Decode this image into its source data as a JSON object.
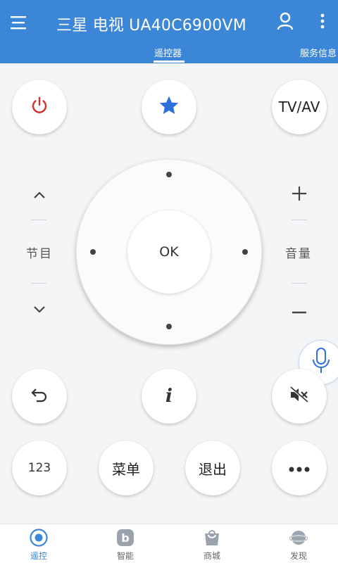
{
  "header": {
    "title": "三星 电视 UA40C6900VM",
    "menu_icon": "menu-icon",
    "user_icon": "user-icon",
    "more_icon": "more-vertical-icon",
    "tabs": [
      {
        "label": "遥控器",
        "active": true
      },
      {
        "label": "服务信息",
        "active": false
      }
    ],
    "color": "#3b86d6"
  },
  "remote": {
    "power_icon": "power-icon",
    "favorite_icon": "star-icon",
    "input_label": "TV/AV",
    "channel": {
      "up_icon": "chevron-up-icon",
      "label": "节目",
      "down_icon": "chevron-down-icon"
    },
    "volume": {
      "up_icon": "plus-icon",
      "label": "音量",
      "down_icon": "minus-icon"
    },
    "dpad": {
      "ok_label": "OK"
    },
    "back_icon": "back-arrow-icon",
    "info_icon": "info-icon",
    "mute_icon": "mute-icon",
    "number_label": "123",
    "menu_label": "菜单",
    "exit_label": "退出",
    "more_icon": "more-horizontal-icon",
    "voice_icon": "microphone-icon"
  },
  "bottom_nav": [
    {
      "label": "遥控",
      "icon": "remote-icon",
      "active": true
    },
    {
      "label": "智能",
      "icon": "smart-icon",
      "active": false
    },
    {
      "label": "商城",
      "icon": "shop-icon",
      "active": false
    },
    {
      "label": "发现",
      "icon": "discover-icon",
      "active": false
    }
  ],
  "colors": {
    "accent": "#3b86d6",
    "power": "#d32f2f",
    "star": "#2f6fd8"
  }
}
